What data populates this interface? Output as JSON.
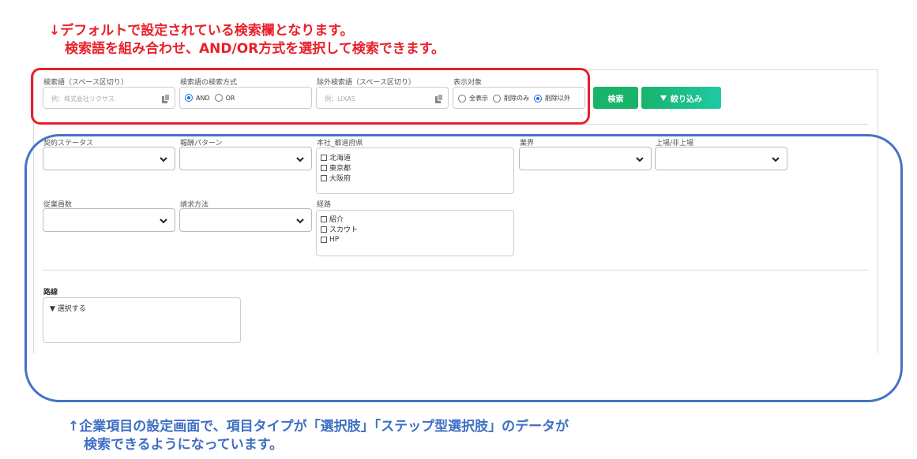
{
  "annotations": {
    "top": {
      "line1": "↓デフォルトで設定されている検索欄となります。",
      "line2": "検索語を組み合わせ、AND/OR方式を選択して検索できます。",
      "color": "#e8202a"
    },
    "bottom": {
      "line1": "↑企業項目の設定画面で、項目タイプが「選択肢」「ステップ型選択肢」のデータが",
      "line2": "検索できるようになっています。",
      "color": "#3e6fc4"
    }
  },
  "search": {
    "keyword": {
      "label": "検索語（スペース区切り）",
      "placeholder": "例：株式会社リクサス"
    },
    "method": {
      "label": "検索語の検索方式",
      "options": [
        "AND",
        "OR"
      ],
      "selected": "AND"
    },
    "exclude": {
      "label": "除外検索語（スペース区切り）",
      "placeholder": "例：LIXAS"
    },
    "display": {
      "label": "表示対象",
      "options": [
        "全表示",
        "削除のみ",
        "削除以外"
      ],
      "selected": "削除以外"
    },
    "search_button": "検索",
    "filter_button": "絞り込み"
  },
  "filters": {
    "contract_status": {
      "label": "契約ステータス"
    },
    "reward_pattern": {
      "label": "報酬パターン"
    },
    "prefecture": {
      "label": "本社_都道府県",
      "options": [
        "北海道",
        "東京都",
        "大阪府"
      ]
    },
    "industry": {
      "label": "業界"
    },
    "listing": {
      "label": "上場/非上場"
    },
    "employees": {
      "label": "従業員数"
    },
    "billing": {
      "label": "請求方法"
    },
    "route": {
      "label": "経路",
      "options": [
        "紹介",
        "スカウト",
        "HP"
      ]
    },
    "line": {
      "label": "路線",
      "toggle": "▼ 選択する"
    }
  },
  "colors": {
    "accent_green": "#19b36b",
    "highlight_red": "#e8202a",
    "highlight_blue": "#4572c4"
  }
}
